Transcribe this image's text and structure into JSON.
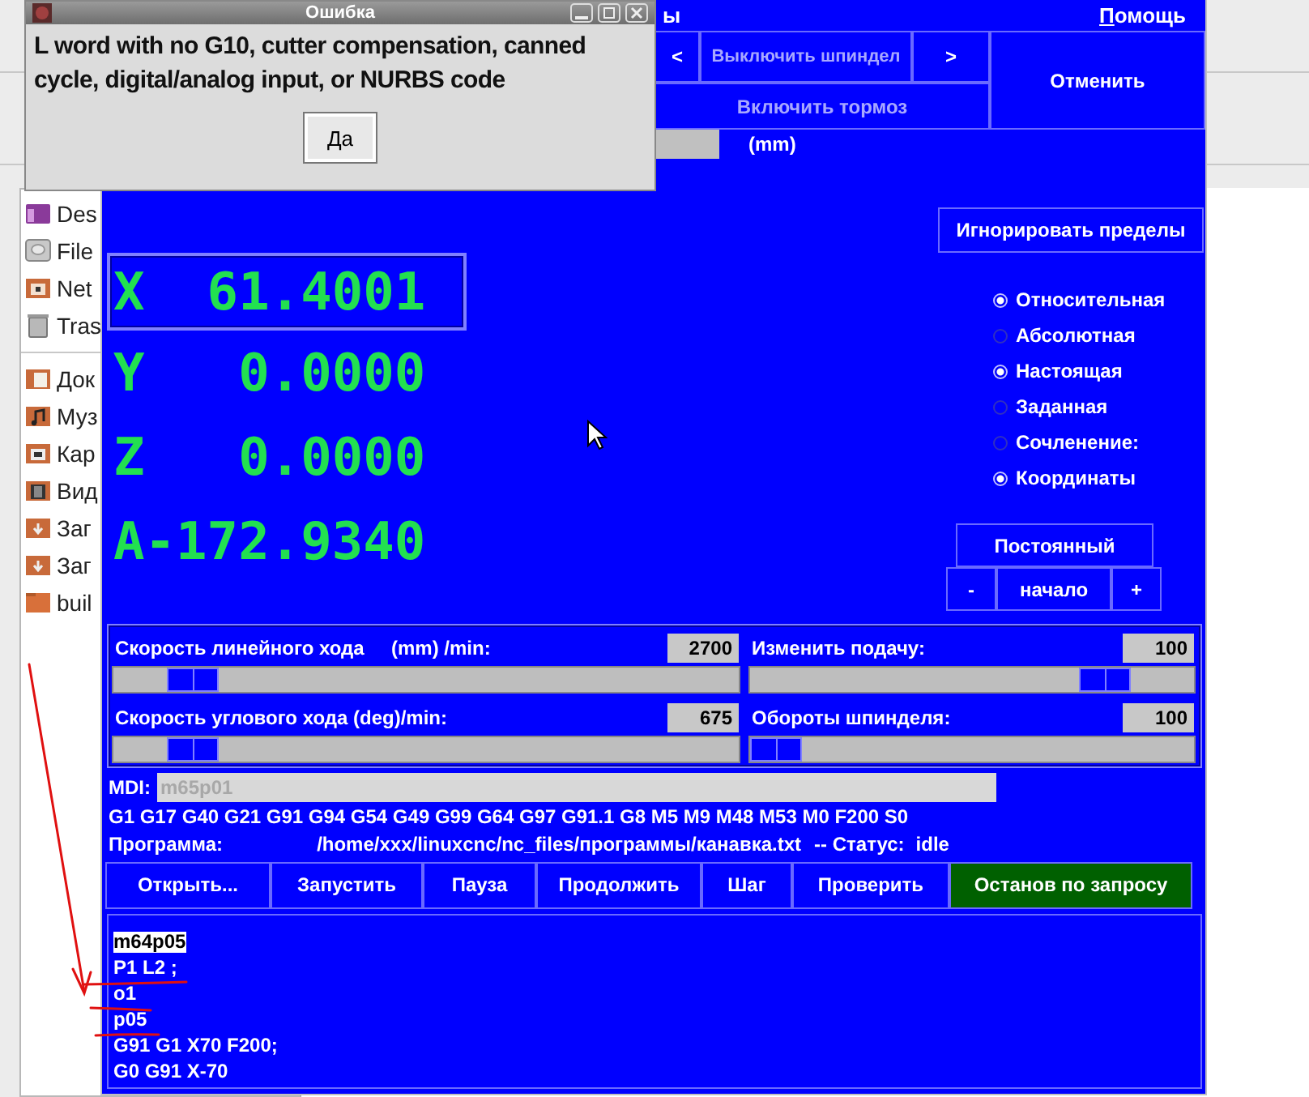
{
  "file_manager": {
    "groups": [
      [
        {
          "label": "Des",
          "kind": "desktop"
        },
        {
          "label": "File",
          "kind": "drive"
        },
        {
          "label": "Net",
          "kind": "network"
        },
        {
          "label": "Tras",
          "kind": "trash"
        }
      ],
      [
        {
          "label": "Док",
          "kind": "documents"
        },
        {
          "label": "Муз",
          "kind": "music"
        },
        {
          "label": "Кар",
          "kind": "pictures"
        },
        {
          "label": "Вид",
          "kind": "video"
        },
        {
          "label": "Заг",
          "kind": "download"
        },
        {
          "label": "Заг",
          "kind": "download"
        },
        {
          "label": "buil",
          "kind": "folder"
        }
      ]
    ]
  },
  "main_window": {
    "menu": [
      {
        "label": "ы",
        "mnemonic_underlined": false
      },
      {
        "label": "Помощь",
        "mnemonic_underlined": true
      }
    ],
    "spindle": {
      "reverse": {
        "label": "<",
        "disabled": false
      },
      "stop": {
        "label": "Выключить шпиндел",
        "disabled": true
      },
      "forward": {
        "label": ">",
        "disabled": false
      },
      "brake": {
        "label": "Включить тормоз",
        "disabled": true
      }
    },
    "abort_button": "Отменить",
    "jog": {
      "units": "(mm)"
    },
    "override_limits_button": "Игнорировать пределы",
    "dro": [
      {
        "axis": "X",
        "value": "61.4001",
        "selected": true
      },
      {
        "axis": "Y",
        "value": "0.0000",
        "selected": false
      },
      {
        "axis": "Z",
        "value": "0.0000",
        "selected": false
      },
      {
        "axis": "A",
        "value": "-172.9340",
        "selected": false
      }
    ],
    "display_options": [
      {
        "label": "Относительная",
        "selected": true
      },
      {
        "label": "Абсолютная",
        "selected": false
      },
      {
        "label": "Настоящая",
        "selected": true
      },
      {
        "label": "Заданная",
        "selected": false
      },
      {
        "label": "Сочленение:",
        "selected": false
      },
      {
        "label": "Координаты",
        "selected": true
      }
    ],
    "home_controls": {
      "mode": "Постоянный",
      "minus": "-",
      "home": "начало",
      "plus": "+"
    },
    "sliders": [
      {
        "label": "Скорость линейного хода     (mm) /min:",
        "value": "2700",
        "level": 0.094
      },
      {
        "label": "Изменить подачу:",
        "value": "100",
        "level": 0.84
      },
      {
        "label": "Скорость углового хода (deg)/min:",
        "value": "675",
        "level": 0.094
      },
      {
        "label": "Обороты шпинделя:",
        "value": "100",
        "level": 0
      }
    ],
    "mdi": {
      "label": "MDI:",
      "value": "m65p01",
      "disabled": true
    },
    "modal_codes": "G1 G17 G40 G21 G91 G94 G54 G49 G99 G64 G97 G91.1 G8 M5 M9 M48 M53 M0 F200 S0",
    "program": {
      "label": "Программа:",
      "path": "/home/xxx/linuxcnc/nc_files/программы/канавка.txt",
      "status_label": "-- Статус:",
      "status": "idle"
    },
    "buttons": [
      {
        "label": "Открыть...",
        "on": false
      },
      {
        "label": "Запустить",
        "on": false
      },
      {
        "label": "Пауза",
        "on": false
      },
      {
        "label": "Продолжить",
        "on": false
      },
      {
        "label": "Шаг",
        "on": false
      },
      {
        "label": "Проверить",
        "on": false
      },
      {
        "label": "Останов по запросу",
        "on": true
      }
    ],
    "code_lines": [
      {
        "text": "m64p05",
        "selected": true
      },
      {
        "text": "P1 L2 ;",
        "selected": false
      },
      {
        "text": "o1",
        "selected": false
      },
      {
        "text": "p05",
        "selected": false
      },
      {
        "text": "G91 G1 X70 F200;",
        "selected": false
      },
      {
        "text": "G0 G91 X-70",
        "selected": false
      }
    ]
  },
  "dialog": {
    "title": "Ошибка",
    "message": "L word with no G10, cutter compensation, canned cycle, digital/analog input, or NURBS code",
    "buttons": [
      "Да"
    ]
  }
}
